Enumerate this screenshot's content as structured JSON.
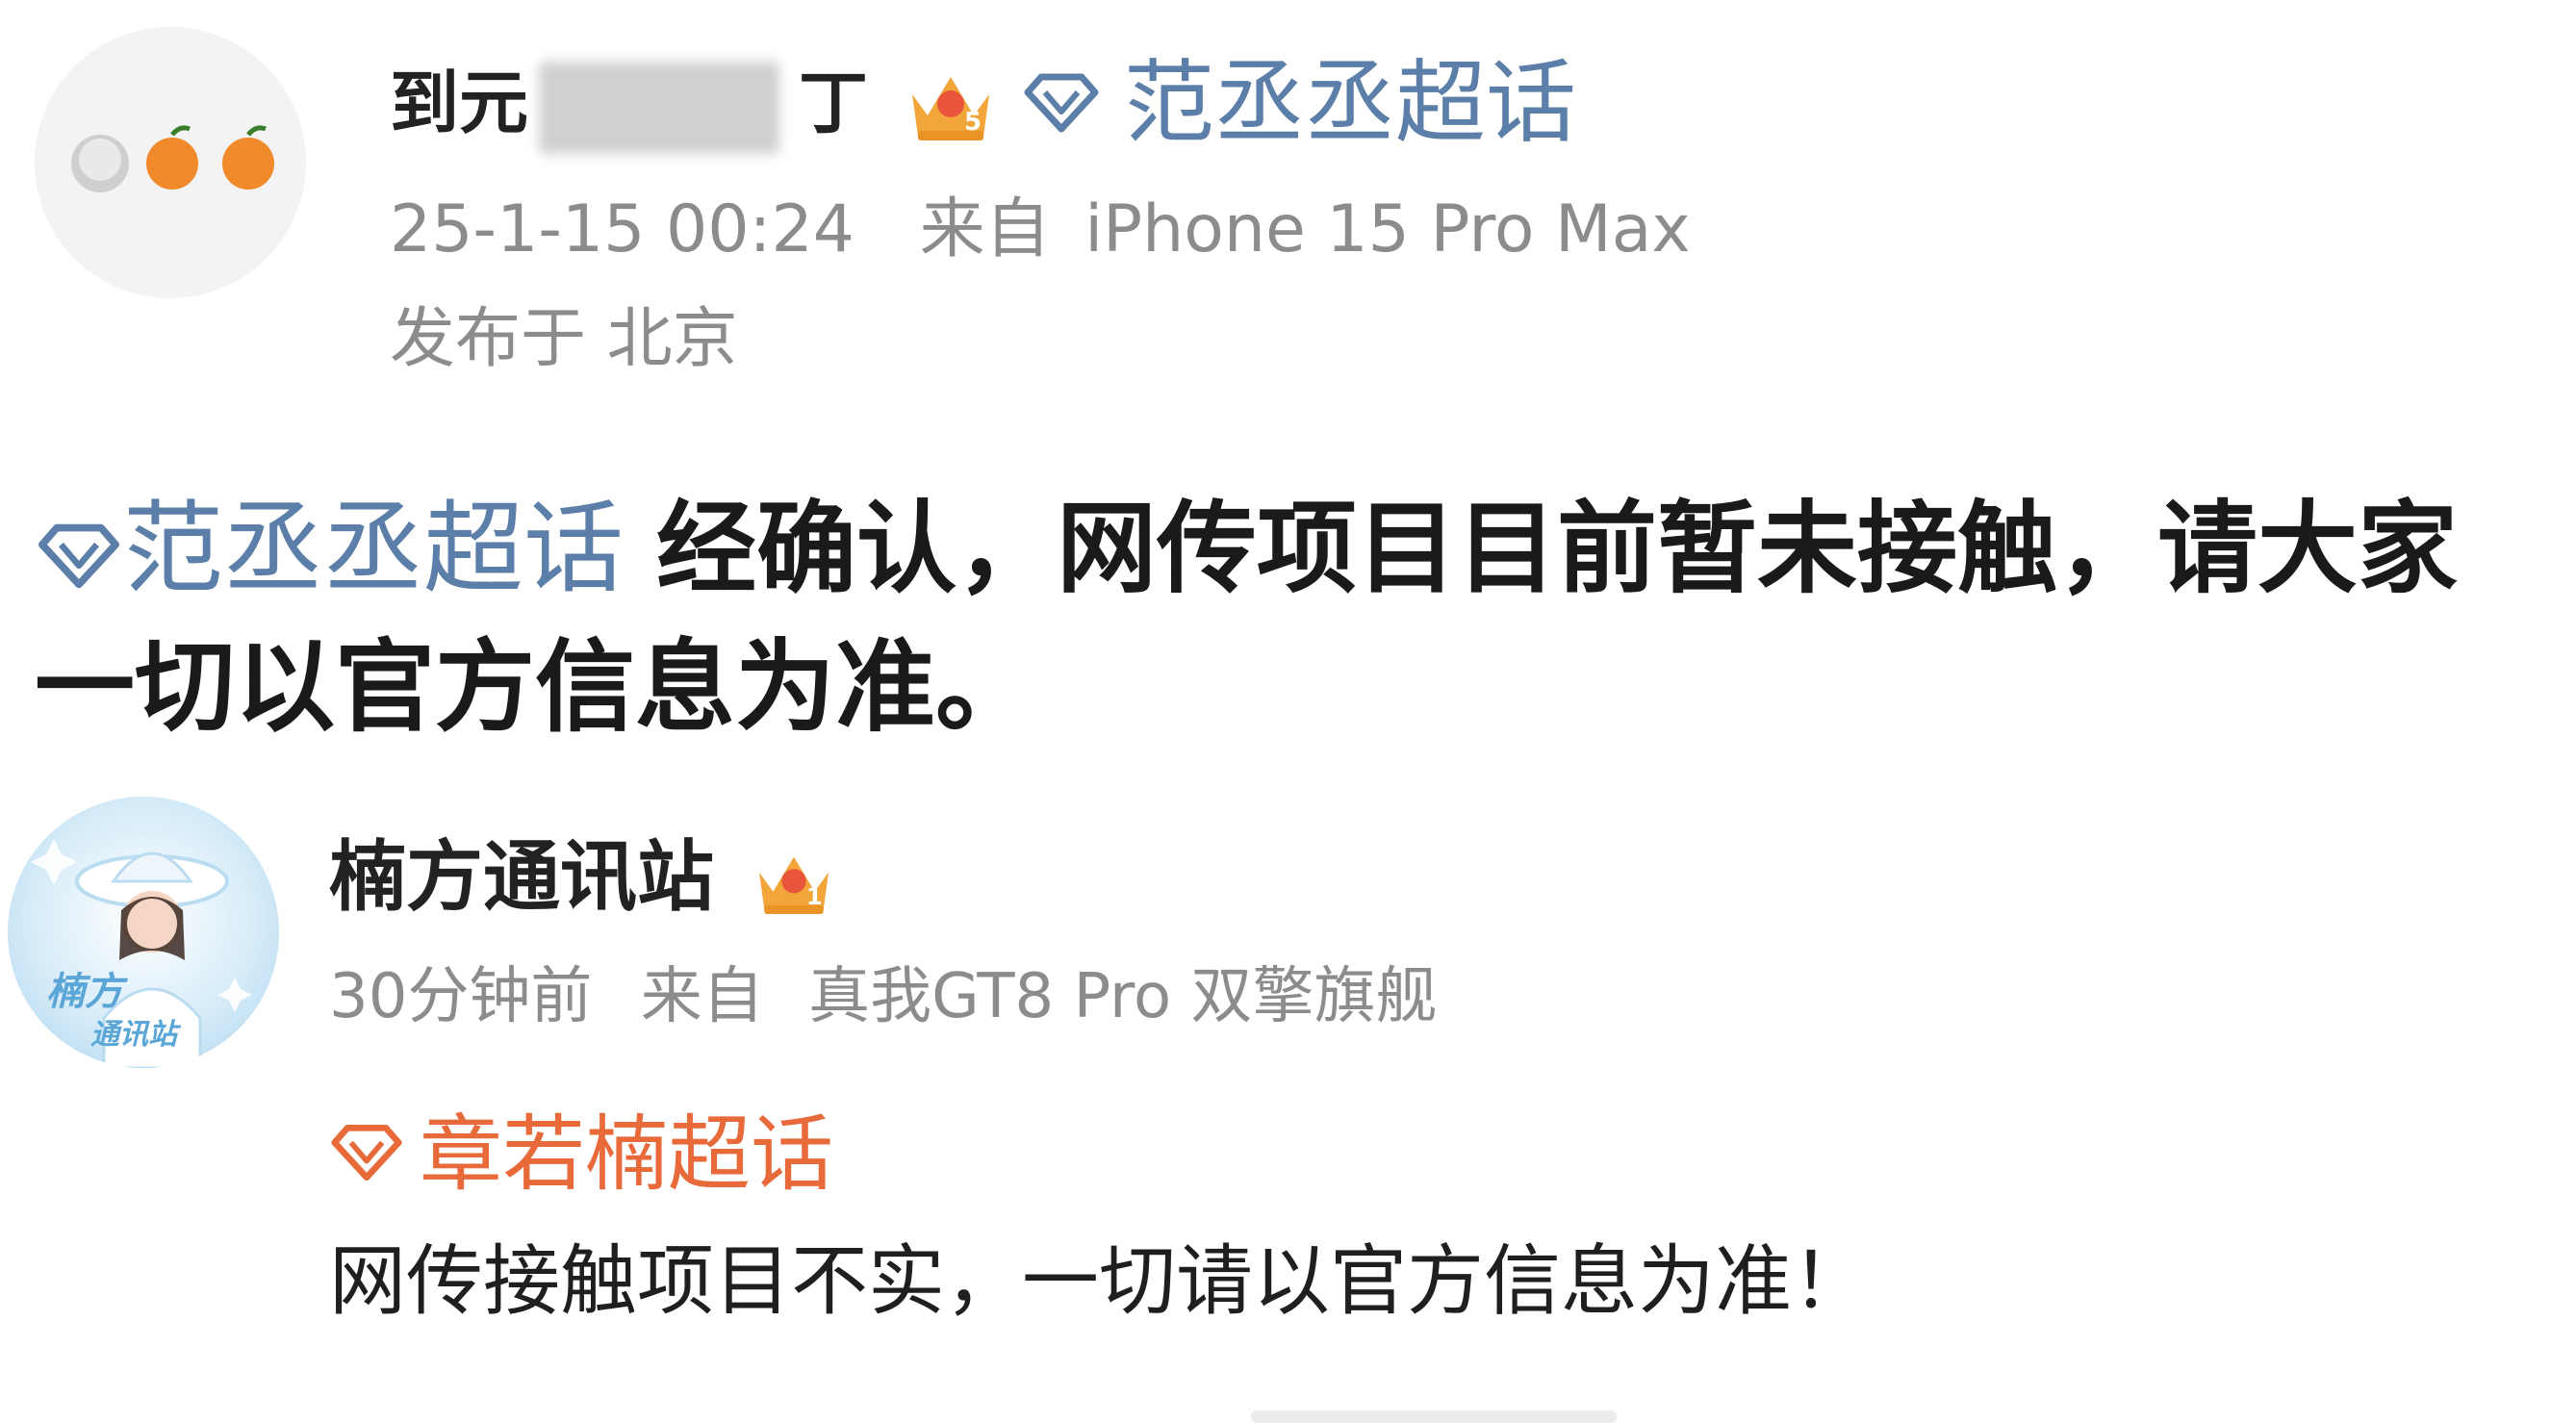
{
  "post1": {
    "username_visible": "到元",
    "username_tail": "丁",
    "level_badge": "5",
    "topic": "范丞丞超话",
    "timestamp": "25-1-15 00:24",
    "source_prefix": "来自",
    "device": "iPhone 15 Pro Max",
    "location": "发布于 北京",
    "body_topic": "范丞丞超话",
    "body_text": "经确认，网传项目目前暂未接触，请大家",
    "body_text_line2": "一切以官方信息为准。"
  },
  "post2": {
    "username": "楠方通讯站",
    "level_badge": "1",
    "avatar_label_top": "楠方",
    "avatar_label_bottom": "通讯站",
    "timestamp": "30分钟前",
    "source_prefix": "来自",
    "device": "真我GT8 Pro 双擎旗舰",
    "topic": "章若楠超话",
    "body_text": "网传接触项目不实，一切请以官方信息为准！"
  },
  "colors": {
    "topic_blue": "#5b7fa8",
    "topic_orange": "#e8693a",
    "meta_gray": "#8c8c8c",
    "crown_gold": "#f2a63a",
    "fruit_orange": "#f08a2a"
  }
}
